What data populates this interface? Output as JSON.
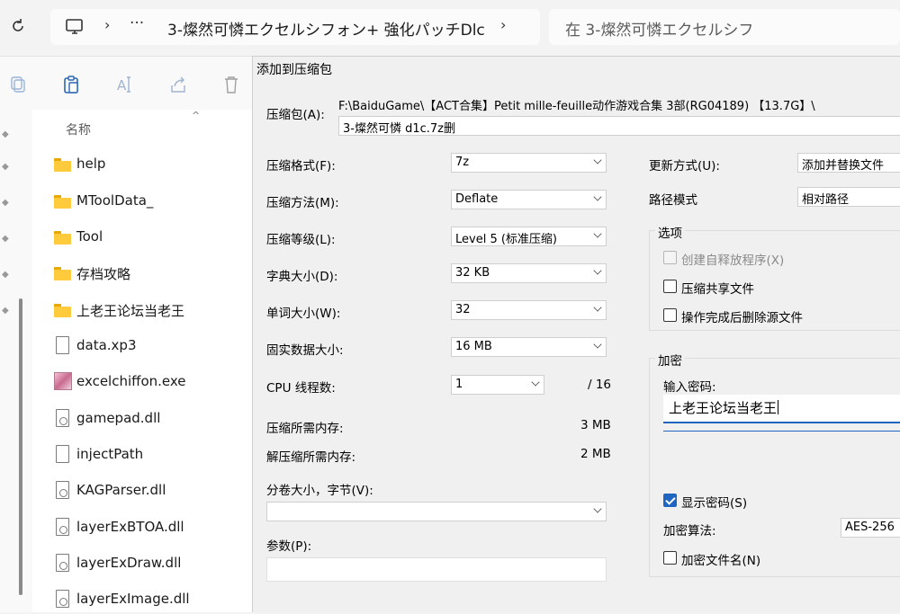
{
  "address_bar": {
    "breadcrumb_current": "3-燦然可憐エクセルシフォン+ 強化パッチDlc",
    "more_label": "···",
    "search_placeholder": "在 3-燦然可憐エクセルシフ"
  },
  "explorer": {
    "column_header": "名称",
    "files": [
      {
        "name": "help",
        "type": "folder"
      },
      {
        "name": "MToolData_",
        "type": "folder"
      },
      {
        "name": "Tool",
        "type": "folder"
      },
      {
        "name": "存档攻略",
        "type": "folder"
      },
      {
        "name": "上老王论坛当老王",
        "type": "folder"
      },
      {
        "name": "data.xp3",
        "type": "file"
      },
      {
        "name": "excelchiffon.exe",
        "type": "exe"
      },
      {
        "name": "gamepad.dll",
        "type": "dll"
      },
      {
        "name": "injectPath",
        "type": "file"
      },
      {
        "name": "KAGParser.dll",
        "type": "dll"
      },
      {
        "name": "layerExBTOA.dll",
        "type": "dll"
      },
      {
        "name": "layerExDraw.dll",
        "type": "dll"
      },
      {
        "name": "layerExImage.dll",
        "type": "dll"
      }
    ]
  },
  "dialog": {
    "title": "添加到压缩包",
    "archive_label": "压缩包(A):",
    "archive_path": "F:\\BaiduGame\\【ACT合集】Petit mille-feuille动作游戏合集 3部(RG04189) 【13.7G】\\",
    "archive_name": "3-燦然可憐 d1c.7z删",
    "format_label": "压缩格式(F):",
    "format_value": "7z",
    "method_label": "压缩方法(M):",
    "method_value": "Deflate",
    "level_label": "压缩等级(L):",
    "level_value": "Level 5 (标准压缩)",
    "dict_label": "字典大小(D):",
    "dict_value": "32 KB",
    "word_label": "单词大小(W):",
    "word_value": "32",
    "solid_label": "固实数据大小:",
    "solid_value": "16 MB",
    "cpu_label": "CPU 线程数:",
    "cpu_value": "1",
    "cpu_max": "/ 16",
    "mem_comp_label": "压缩所需内存:",
    "mem_comp_value": "3 MB",
    "mem_decomp_label": "解压缩所需内存:",
    "mem_decomp_value": "2 MB",
    "volume_label": "分卷大小，字节(V):",
    "volume_value": "",
    "params_label": "参数(P):",
    "params_value": "",
    "update_label": "更新方式(U):",
    "update_value": "添加并替换文件",
    "path_label": "路径模式",
    "path_value": "相对路径",
    "options": {
      "title": "选项",
      "sfx": "创建自释放程序(X)",
      "shared": "压缩共享文件",
      "delete_after": "操作完成后删除源文件"
    },
    "encryption": {
      "title": "加密",
      "password_label": "输入密码:",
      "password_value": "上老王论坛当老王",
      "show_password": "显示密码(S)",
      "method_label": "加密算法:",
      "method_value": "AES-256",
      "encrypt_names": "加密文件名(N)"
    }
  }
}
